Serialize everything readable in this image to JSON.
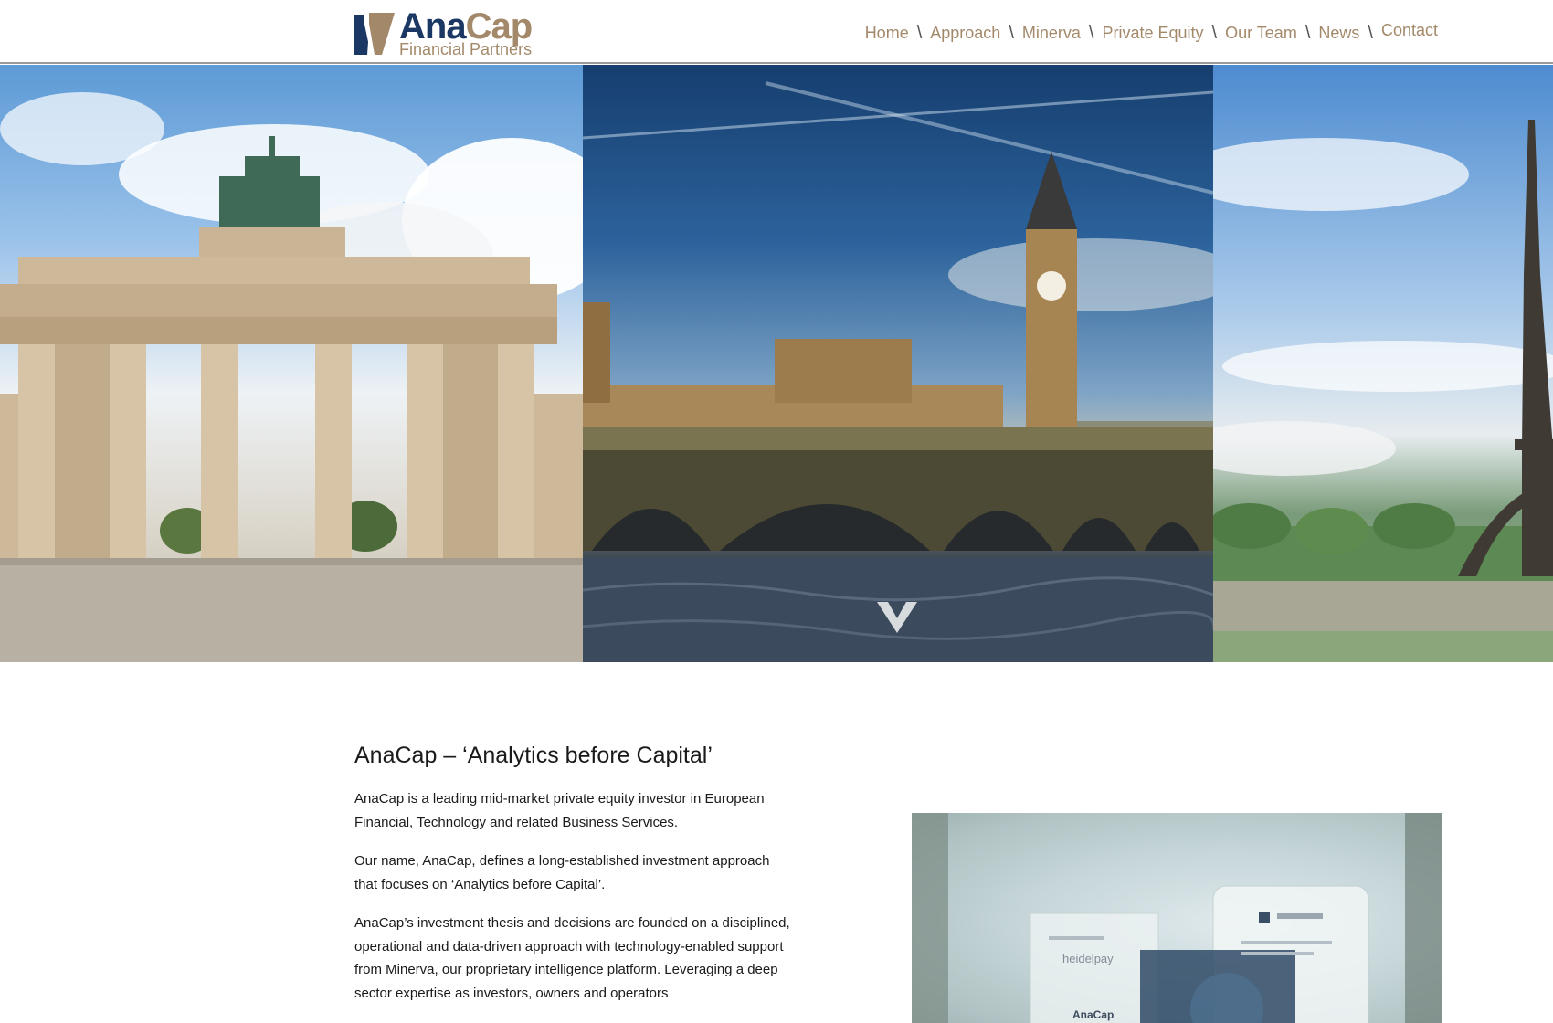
{
  "logo": {
    "brand_main": "Ana",
    "brand_accent": "Cap",
    "subtitle": "Financial Partners"
  },
  "nav": {
    "items": [
      "Home",
      "Approach",
      "Minerva",
      "Private Equity",
      "Our Team",
      "News",
      "Contact"
    ],
    "separator": "\\"
  },
  "hero": {
    "panels": [
      "brandenburg-gate",
      "westminster-bridge-big-ben",
      "eiffel-tower"
    ],
    "scroll_icon": "chevron-down-icon"
  },
  "intro": {
    "heading": "AnaCap – ‘Analytics before Capital’",
    "paragraphs": [
      "AnaCap is a leading mid-market private equity investor in European Financial, Technology and related Business Services.",
      "Our name, AnaCap, defines a long-established investment approach that focuses on ‘Analytics before Capital’.",
      "AnaCap’s investment thesis and decisions are founded on a disciplined, operational and data-driven approach with technology-enabled support from Minerva, our proprietary intelligence platform. Leveraging a deep sector expertise as investors, owners and operators"
    ]
  },
  "photo": {
    "awards": [
      "heidelpay",
      "AnaCap"
    ]
  },
  "colors": {
    "brand_navy": "#1b3864",
    "brand_gold": "#a3896a",
    "header_rule": "#9a9a9a"
  }
}
